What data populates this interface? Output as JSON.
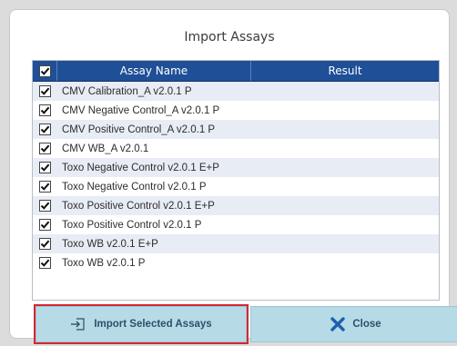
{
  "dialog": {
    "title": "Import Assays"
  },
  "table": {
    "columns": [
      "Assay Name",
      "Result"
    ],
    "rows": [
      {
        "name": "CMV Calibration_A v2.0.1 P",
        "checked": true
      },
      {
        "name": "CMV Negative Control_A v2.0.1 P",
        "checked": true
      },
      {
        "name": "CMV Positive Control_A v2.0.1 P",
        "checked": true
      },
      {
        "name": "CMV WB_A v2.0.1",
        "checked": true
      },
      {
        "name": "Toxo Negative Control v2.0.1 E+P",
        "checked": true
      },
      {
        "name": "Toxo Negative Control v2.0.1 P",
        "checked": true
      },
      {
        "name": "Toxo Positive Control v2.0.1 E+P",
        "checked": true
      },
      {
        "name": "Toxo Positive Control v2.0.1 P",
        "checked": true
      },
      {
        "name": "Toxo WB v2.0.1 E+P",
        "checked": true
      },
      {
        "name": "Toxo WB v2.0.1 P",
        "checked": true
      }
    ]
  },
  "buttons": {
    "import_label": "Import Selected Assays",
    "close_label": "Close"
  },
  "icons": {
    "import": "import-icon",
    "close": "close-x-icon"
  },
  "colors": {
    "header_bg": "#1f4f97",
    "button_bg": "#b6dbe7",
    "highlight": "#d7262e",
    "close_x": "#1f5fb0"
  }
}
